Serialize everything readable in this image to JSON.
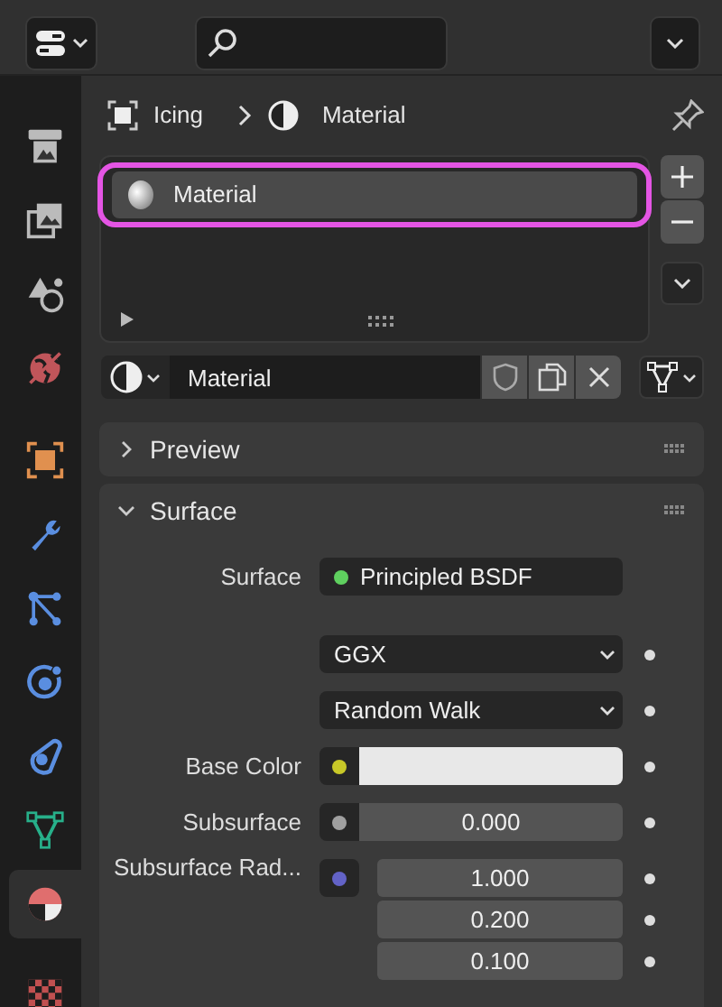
{
  "sidebar": {
    "tab_groups": [
      [
        {
          "kind": "render",
          "selected": false
        },
        {
          "kind": "output",
          "selected": false
        },
        {
          "kind": "scene",
          "selected": false
        },
        {
          "kind": "world",
          "selected": false
        }
      ],
      [
        {
          "kind": "object",
          "selected": false
        },
        {
          "kind": "modifiers",
          "selected": false
        },
        {
          "kind": "particles",
          "selected": false
        },
        {
          "kind": "physics",
          "selected": false
        },
        {
          "kind": "constraints",
          "selected": false
        },
        {
          "kind": "data",
          "selected": false
        },
        {
          "kind": "material",
          "selected": true
        }
      ],
      [
        {
          "kind": "texture",
          "selected": false
        }
      ]
    ]
  },
  "breadcrumb": [
    {
      "kind": "object",
      "label": "Icing"
    },
    {
      "kind": "material",
      "label": "Material"
    }
  ],
  "slot_list": {
    "highlighted": true,
    "items": [
      {
        "name": "Material",
        "selected": true
      }
    ]
  },
  "datablock": {
    "value": "Material"
  },
  "panels": [
    {
      "title": "Preview",
      "expanded": false
    },
    {
      "title": "Surface",
      "expanded": true
    }
  ],
  "surface_properties": [
    {
      "kind": "shader",
      "label": "Surface",
      "color": "#5fd05f",
      "value": "Principled BSDF"
    },
    {
      "kind": "dropdown",
      "value": "GGX"
    },
    {
      "kind": "dropdown",
      "value": "Random Walk"
    },
    {
      "kind": "color",
      "label": "Base Color",
      "color": "#c8c828",
      "swatch": {
        "color": "#e8e8e8"
      }
    },
    {
      "kind": "number",
      "label": "Subsurface",
      "color": "#a0a0a0",
      "value": "0.000"
    },
    {
      "kind": "vector",
      "label": "Subsurface Rad...",
      "color": "#6363c7",
      "values": [
        "1.000",
        "0.200",
        "0.100"
      ]
    }
  ]
}
